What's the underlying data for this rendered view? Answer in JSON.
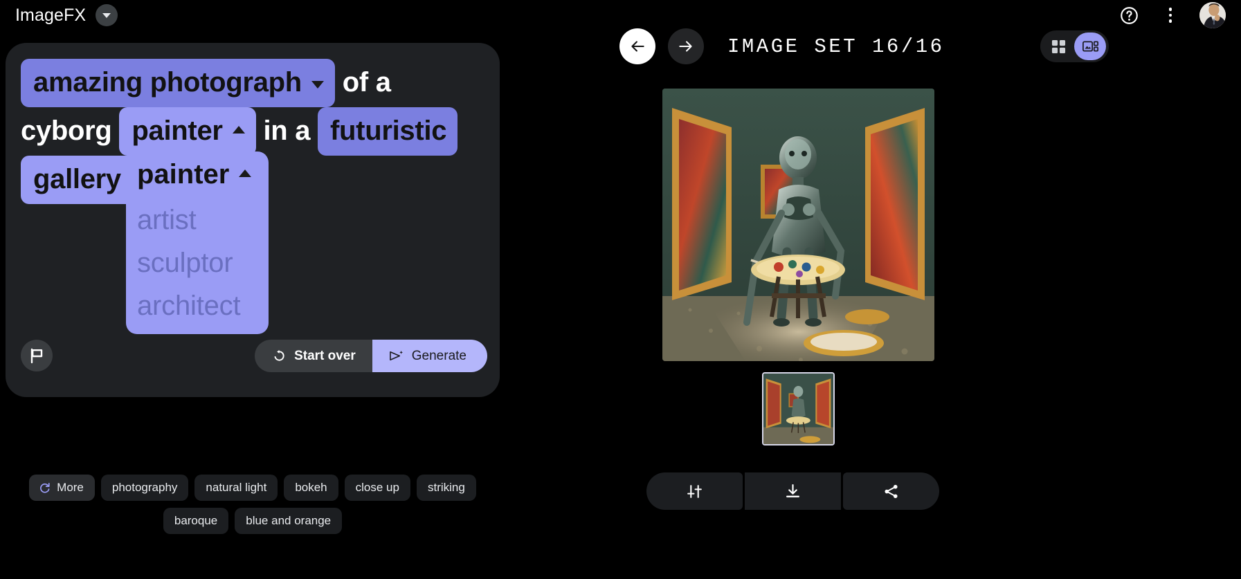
{
  "app": {
    "brand": "ImageFX",
    "brand_caret_icon": "chevron-down-icon",
    "help_icon": "help-circle-icon",
    "menu_icon": "kebab-menu-icon",
    "avatar_icon": "user-avatar"
  },
  "prompt": {
    "segments": [
      {
        "type": "chip",
        "text": "amazing photograph",
        "caret": "down",
        "style": "dark"
      },
      {
        "type": "plain",
        "text": "of a"
      },
      {
        "type": "plain",
        "text": "cyborg"
      },
      {
        "type": "chip",
        "text": "painter",
        "caret": "up",
        "style": "light"
      },
      {
        "type": "plain",
        "text": "in a"
      },
      {
        "type": "chip",
        "text": "futuristic",
        "caret": "none",
        "style": "dark"
      },
      {
        "type": "chip",
        "text": "gallery",
        "caret": "down",
        "style": "light"
      }
    ],
    "full_text": "amazing photograph of a cyborg painter in a futuristic gallery",
    "dropdown": {
      "open": true,
      "selected": "painter",
      "caret_icon": "chevron-up-icon",
      "options": [
        "artist",
        "sculptor",
        "architect"
      ]
    },
    "flag_icon": "flag-icon",
    "start_over_label": "Start over",
    "start_over_icon": "refresh-icon",
    "generate_label": "Generate",
    "generate_icon": "send-sparkle-icon"
  },
  "suggestions": {
    "more_label": "More",
    "more_icon": "refresh-icon",
    "row1": [
      "photography",
      "natural light",
      "bokeh",
      "close up",
      "striking"
    ],
    "row2": [
      "baroque",
      "blue and orange"
    ]
  },
  "image_set": {
    "title": "IMAGE SET 16/16",
    "current": 16,
    "total": 16,
    "prev_icon": "arrow-left-icon",
    "next_icon": "arrow-right-icon",
    "view_grid_icon": "grid-view-icon",
    "view_detail_icon": "detail-view-icon",
    "active_view": "detail",
    "hero_alt": "cyborg painter at easel in gallery",
    "thumb_alt": "cyborg painter thumbnail",
    "actions": [
      {
        "name": "tune-icon",
        "label": "Tune"
      },
      {
        "name": "download-icon",
        "label": "Download"
      },
      {
        "name": "share-icon",
        "label": "Share"
      }
    ]
  },
  "colors": {
    "accent": "#9a9cf5",
    "chip_dark": "#7b7fe0",
    "generate_bg": "#b4b6fb",
    "panel_bg": "#1f2124",
    "page_bg": "#000000"
  }
}
